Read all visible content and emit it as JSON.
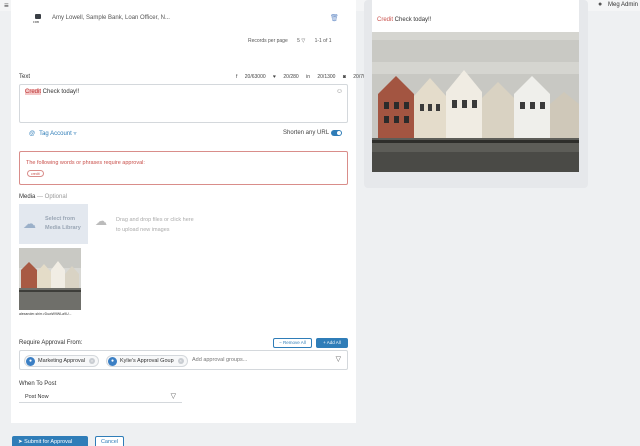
{
  "topbar": {
    "user_name": "Meg Admin"
  },
  "account_row": {
    "logo_text": "FRB",
    "text": "Amy Lowell, Sample Bank, Loan Officer, N..."
  },
  "pager": {
    "records_label": "Records per page",
    "records_value": "5",
    "range": "1-1 of 1"
  },
  "composer": {
    "text_label": "Text",
    "counters": [
      {
        "icon": "facebook-icon",
        "text": "20/63000"
      },
      {
        "icon": "twitter-icon",
        "text": "20/280"
      },
      {
        "icon": "linkedin-icon",
        "text": "20/1300"
      },
      {
        "icon": "instagram-icon",
        "text": "20/700"
      }
    ],
    "highlight_word": "Credit",
    "text_rest": " Check today!!"
  },
  "tag_account_label": "Tag Account",
  "shorten_label": "Shorten any URL",
  "shorten_enabled": true,
  "approval_alert": {
    "message": "The following words or phrases require approval:",
    "chip": "credit"
  },
  "media": {
    "label": "Media",
    "optional": "— Optional",
    "library_line1": "Select from",
    "library_line2": "Media Library",
    "upload_line1": "Drag and drop files or click here",
    "upload_line2": "to upload new images",
    "thumb_caption": "alexander-shirr-rDuwW9WLa9U..."
  },
  "require_approval": {
    "label": "Require Approval From:",
    "remove_all": "− Remove All",
    "add_all": "+ Add All",
    "groups": [
      {
        "name": "Marketing Approval"
      },
      {
        "name": "Kylie's Approval Goup"
      }
    ],
    "placeholder": "Add approval groups..."
  },
  "when_to_post": {
    "label": "When To Post",
    "value": "Post Now"
  },
  "actions": {
    "submit": "Submit for Approval",
    "cancel": "Cancel"
  },
  "preview": {
    "highlight": "Credit",
    "rest": " Check today!!"
  },
  "colors": {
    "accent": "#2f7db8",
    "danger": "#c9504b"
  }
}
